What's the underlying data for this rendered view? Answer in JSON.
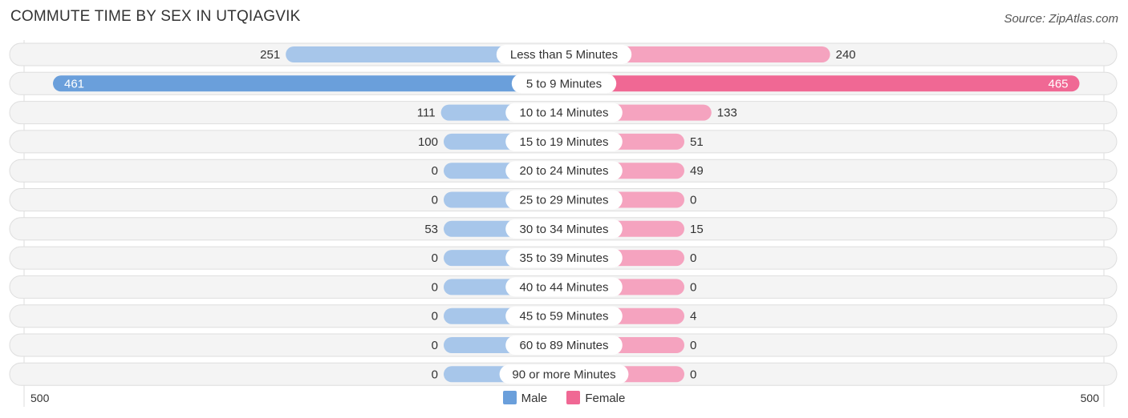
{
  "title": "COMMUTE TIME BY SEX IN UTQIAGVIK",
  "source": "Source: ZipAtlas.com",
  "legend": {
    "male": "Male",
    "female": "Female"
  },
  "axis": {
    "left_label": "500",
    "right_label": "500"
  },
  "colors": {
    "male": "#6a9fdb",
    "male_light": "#a7c6ea",
    "female": "#f06894",
    "female_light": "#f5a3bf"
  },
  "chart_data": {
    "type": "bar",
    "title": "COMMUTE TIME BY SEX IN UTQIAGVIK",
    "orientation": "horizontal-diverging",
    "categories": [
      "Less than 5 Minutes",
      "5 to 9 Minutes",
      "10 to 14 Minutes",
      "15 to 19 Minutes",
      "20 to 24 Minutes",
      "25 to 29 Minutes",
      "30 to 34 Minutes",
      "35 to 39 Minutes",
      "40 to 44 Minutes",
      "45 to 59 Minutes",
      "60 to 89 Minutes",
      "90 or more Minutes"
    ],
    "series": [
      {
        "name": "Male",
        "values": [
          251,
          461,
          111,
          100,
          0,
          0,
          53,
          0,
          0,
          0,
          0,
          0
        ]
      },
      {
        "name": "Female",
        "values": [
          240,
          465,
          133,
          51,
          49,
          0,
          15,
          0,
          0,
          4,
          0,
          0
        ]
      }
    ],
    "xlim": [
      -500,
      500
    ],
    "legend_position": "bottom-center"
  }
}
